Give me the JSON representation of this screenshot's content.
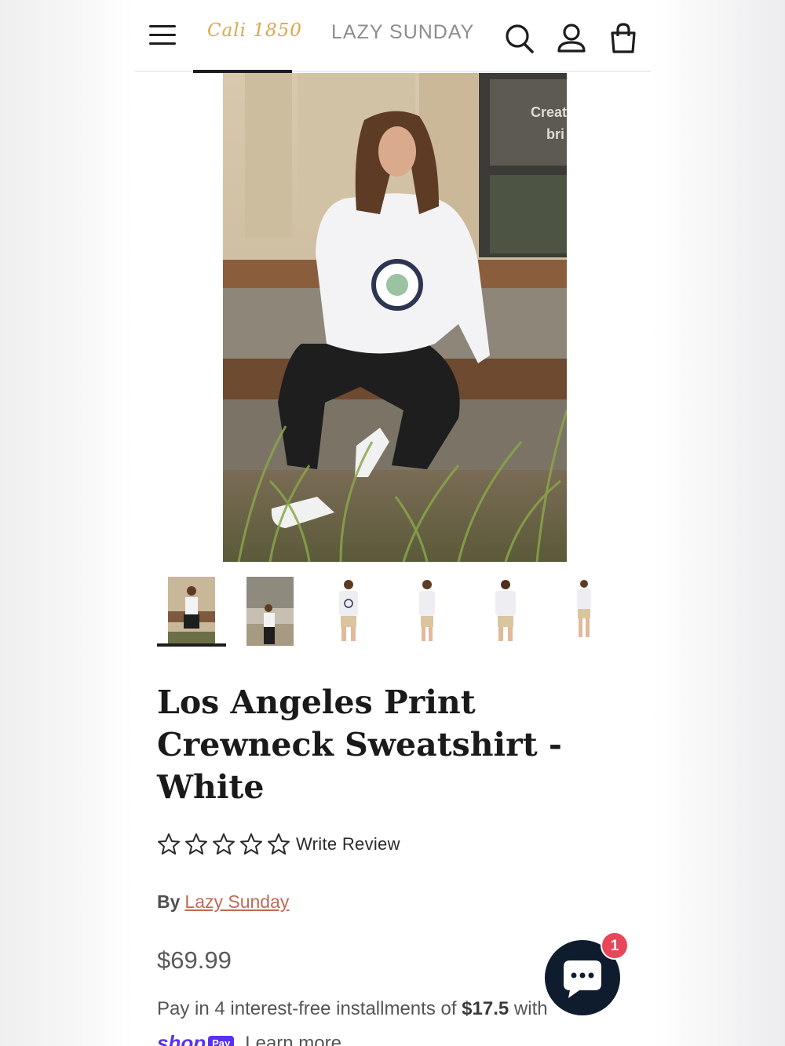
{
  "header": {
    "logo_left": "Cali 1850",
    "logo_main": "LAZY SUNDAY",
    "icons": [
      "menu-icon",
      "search-icon",
      "account-icon",
      "shopping-bag-icon"
    ]
  },
  "hero": {
    "sign_text_1": "Creat",
    "sign_text_2": "bri"
  },
  "thumbnails": {
    "count": 6,
    "active_index": 0
  },
  "product": {
    "title": "Los Angeles Print Crewneck Sweatshirt - White",
    "rating": 0,
    "rating_max": 5,
    "write_review": "Write Review",
    "by_label": "By",
    "brand": "Lazy Sunday",
    "price": "$69.99",
    "installments_prefix": "Pay in 4 interest-free installments of ",
    "installments_amount": "$17.5",
    "installments_suffix": "with",
    "shoppay_shop": "shop",
    "shoppay_pay": "Pay",
    "learn_more": "Learn more"
  },
  "chat": {
    "badge": "1"
  },
  "colors": {
    "accent_link": "#c06a55",
    "logo_gold": "#e0a54a",
    "shoppay_purple": "#5a31f4",
    "chat_bg": "#0f1c2e",
    "badge_red": "#e8475a"
  }
}
